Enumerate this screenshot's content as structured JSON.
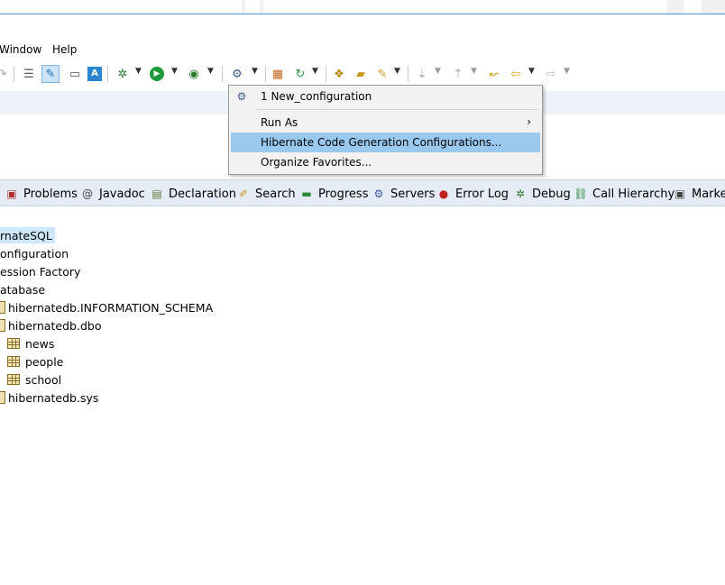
{
  "menubar": {
    "items": [
      {
        "label": "Window"
      },
      {
        "label": "Help"
      }
    ]
  },
  "popup": {
    "items": [
      {
        "label": "1 New_configuration"
      },
      {
        "label": "Run As",
        "submenu": true
      },
      {
        "label": "Hibernate Code Generation Configurations...",
        "highlighted": true
      },
      {
        "label": "Organize Favorites..."
      }
    ]
  },
  "views": {
    "tabs": [
      {
        "label": "Problems"
      },
      {
        "label": "Javadoc"
      },
      {
        "label": "Declaration"
      },
      {
        "label": "Search"
      },
      {
        "label": "Progress"
      },
      {
        "label": "Servers"
      },
      {
        "label": "Error Log"
      },
      {
        "label": "Debug"
      },
      {
        "label": "Call Hierarchy"
      },
      {
        "label": "Marke"
      }
    ]
  },
  "tree": {
    "nodes": [
      {
        "label": "rnateSQL"
      },
      {
        "label": "onfiguration"
      },
      {
        "label": "ession Factory"
      },
      {
        "label": "atabase"
      },
      {
        "label": "hibernatedb.INFORMATION_SCHEMA"
      },
      {
        "label": "hibernatedb.dbo"
      },
      {
        "label": "news"
      },
      {
        "label": "people"
      },
      {
        "label": "school"
      },
      {
        "label": "hibernatedb.sys"
      }
    ]
  },
  "colors": {
    "highlight": "#99c9ef",
    "tree_selection": "#cde8fa",
    "views_bar": "#e6ecf5"
  }
}
